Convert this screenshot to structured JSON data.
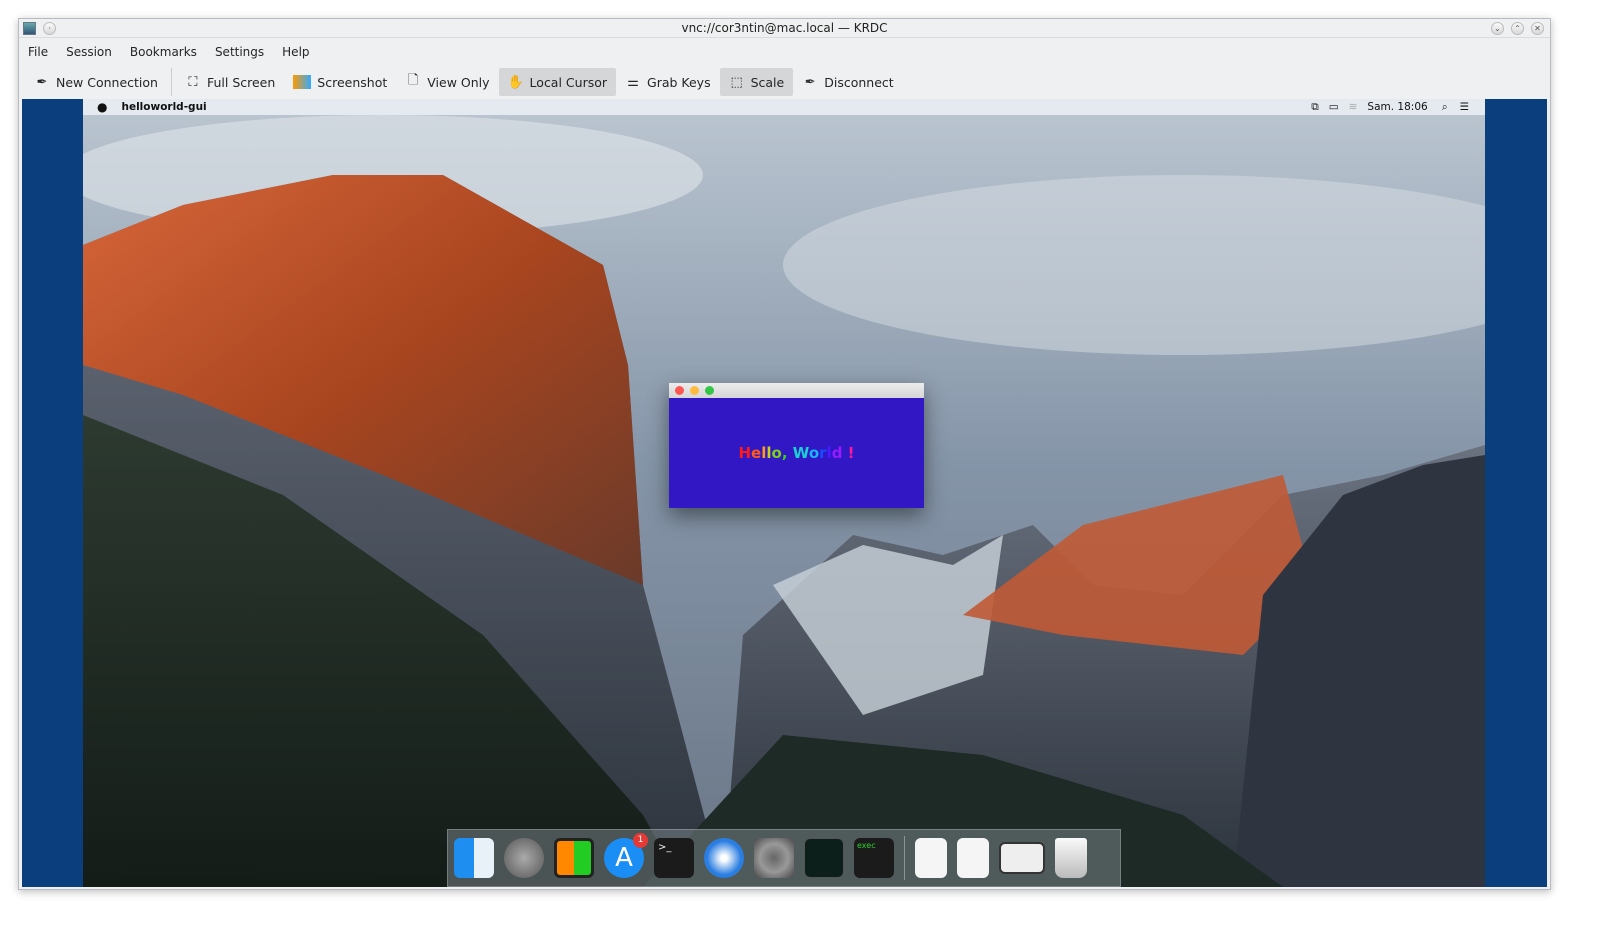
{
  "window": {
    "title": "vnc://cor3ntin@mac.local — KRDC"
  },
  "menu": [
    "File",
    "Session",
    "Bookmarks",
    "Settings",
    "Help"
  ],
  "toolbar": {
    "new_connection": "New Connection",
    "full_screen": "Full Screen",
    "screenshot": "Screenshot",
    "view_only": "View Only",
    "local_cursor": "Local Cursor",
    "grab_keys": "Grab Keys",
    "scale": "Scale",
    "disconnect": "Disconnect"
  },
  "mac": {
    "app_name": "helloworld-gui",
    "clock": "Sam. 18:06"
  },
  "hello": {
    "letters": [
      [
        "H",
        "#ff1a1a"
      ],
      [
        "e",
        "#ff5a1a"
      ],
      [
        "l",
        "#ff9a1a"
      ],
      [
        "l",
        "#c8d21a"
      ],
      [
        "o",
        "#7ad21a"
      ],
      [
        ",",
        "#3ad21a"
      ],
      [
        " ",
        ""
      ],
      [
        "W",
        "#1ad2d2"
      ],
      [
        "o",
        "#1ab4ff"
      ],
      [
        "r",
        "#1a4aff"
      ],
      [
        "l",
        "#4a1aff"
      ],
      [
        "d",
        "#9a1aff"
      ],
      [
        " ",
        ""
      ],
      [
        "!",
        "#ff1a9a"
      ]
    ],
    "text": "Hello, World !"
  },
  "dock": {
    "apps": [
      "Finder",
      "Launchpad",
      "Mission Control",
      "App Store",
      "Terminal",
      "Safari",
      "System Preferences",
      "Activity Monitor",
      "exec"
    ],
    "app_store_badge": "1",
    "exec_label": "exec"
  }
}
